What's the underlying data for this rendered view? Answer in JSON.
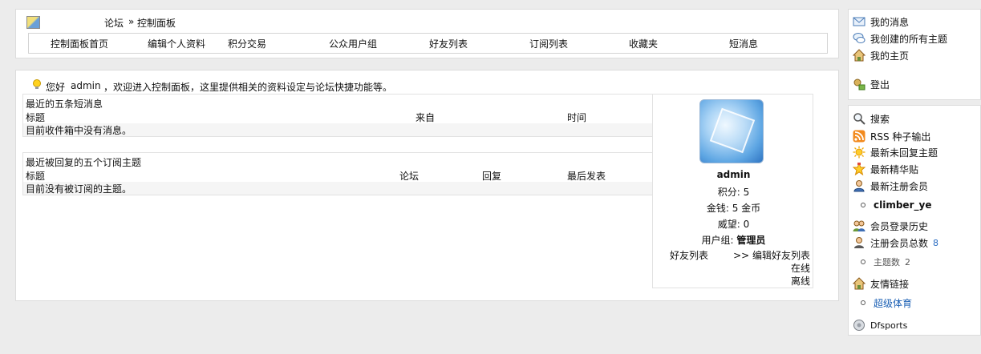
{
  "breadcrumb": {
    "forum": "论坛",
    "separator": "»",
    "current": "控制面板"
  },
  "nav": [
    "控制面板首页",
    "编辑个人资料",
    "积分交易",
    "公众用户组",
    "好友列表",
    "订阅列表",
    "收藏夹",
    "短消息"
  ],
  "welcome": {
    "greeting": "您好",
    "user": "admin",
    "message": "，欢迎进入控制面板，这里提供相关的资料设定与论坛快捷功能等。"
  },
  "messages_section": {
    "title": "最近的五条短消息",
    "headers": [
      "标题",
      "来自",
      "时间"
    ],
    "empty_text": "目前收件箱中没有消息。"
  },
  "subs_section": {
    "title": "最近被回复的五个订阅主题",
    "headers": [
      "标题",
      "论坛",
      "回复",
      "最后发表"
    ],
    "empty_text": "目前没有被订阅的主题。"
  },
  "profile": {
    "username": "admin",
    "points_label": "积分:",
    "points_value": "5",
    "money_label": "金钱:",
    "money_value": "5 金币",
    "prestige_label": "威望:",
    "prestige_value": "0",
    "group_label": "用户组:",
    "group_value": "管理员",
    "friends_label": "好友列表",
    "edit_friends": ">> 编辑好友列表",
    "online": "在线",
    "offline": "离线"
  },
  "sidebar_top": [
    {
      "label": "我的消息",
      "icon": "mail-icon"
    },
    {
      "label": "我创建的所有主题",
      "icon": "speech-bubble-icon"
    },
    {
      "label": "我的主页",
      "icon": "home-icon"
    },
    {
      "label": "登出",
      "icon": "logout-icon"
    }
  ],
  "sidebar_bottom": {
    "search": "搜索",
    "rss": "RSS 种子输出",
    "latest_unreplied": "最新未回复主题",
    "latest_digest": "最新精华贴",
    "latest_member_label": "最新注册会员",
    "latest_member": "climber_ye",
    "login_history": "会员登录历史",
    "total_members_label": "注册会员总数",
    "total_members": "8",
    "topics_label": "主题数",
    "topics": "2",
    "friend_links": "友情链接",
    "link_1": "超级体育",
    "dfsports": "Dfsports"
  },
  "colors": {
    "page_bg": "#ececec",
    "panel_bg": "#ffffff",
    "link_blue": "#1a5fb4"
  }
}
